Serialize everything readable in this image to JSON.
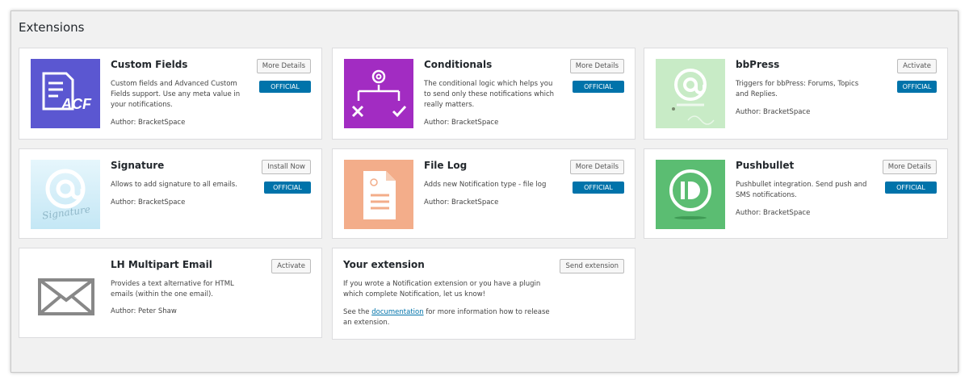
{
  "page": {
    "title": "Extensions"
  },
  "common": {
    "official": "OFFICIAL"
  },
  "cards": [
    {
      "title": "Custom Fields",
      "description": "Custom fields and Advanced Custom Fields support. Use any meta value in your notifications.",
      "author": "Author: BracketSpace",
      "action": "More Details",
      "thumb_color": "#5b57d1"
    },
    {
      "title": "Conditionals",
      "description": "The conditional logic which helps you to send only these notifications which really matters.",
      "author": "Author: BracketSpace",
      "action": "More Details",
      "thumb_color": "#a22cc2"
    },
    {
      "title": "bbPress",
      "description": "Triggers for bbPress: Forums, Topics and Replies.",
      "author": "Author: BracketSpace",
      "action": "Activate",
      "thumb_color": "#c8ebc6"
    },
    {
      "title": "Signature",
      "description": "Allows to add signature to all emails.",
      "author": "Author: BracketSpace",
      "action": "Install Now",
      "thumb_color": "#d4eef8",
      "thumb_text": "Signature"
    },
    {
      "title": "File Log",
      "description": "Adds new Notification type - file log",
      "author": "Author: BracketSpace",
      "action": "More Details",
      "thumb_color": "#f3ad8a"
    },
    {
      "title": "Pushbullet",
      "description": "Pushbullet integration. Send push and SMS notifications.",
      "author": "Author: BracketSpace",
      "action": "More Details",
      "thumb_color": "#5bbd72"
    },
    {
      "title": "LH Multipart Email",
      "description": "Provides a text alternative for HTML emails (within the one email).",
      "author": "Author: Peter Shaw",
      "action": "Activate"
    }
  ],
  "your_extension": {
    "title": "Your extension",
    "action": "Send extension",
    "text1": "If you wrote a Notification extension or you have a plugin which complete Notification, let us know!",
    "text2_before": "See the",
    "link": "documentation",
    "text2_after": "for more information how to release an extension."
  }
}
